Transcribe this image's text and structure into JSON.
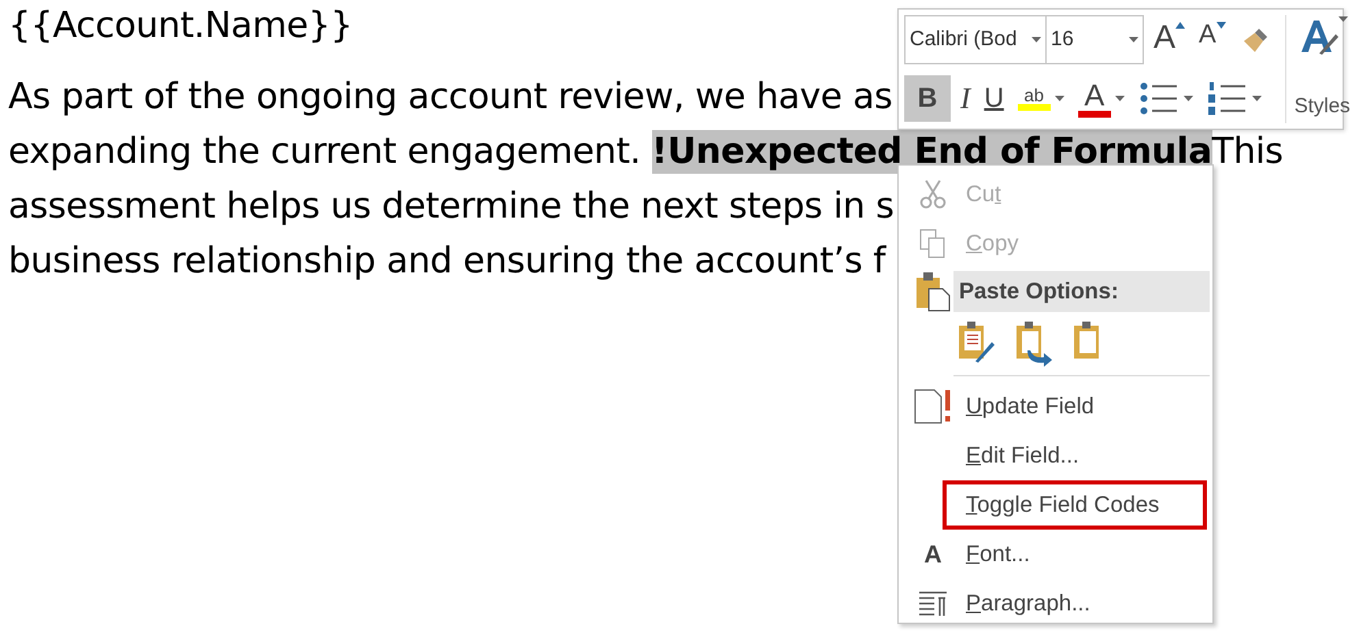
{
  "document": {
    "title": "{{Account.Name}}",
    "lines": [
      {
        "parts": [
          {
            "kind": "text",
            "text": "As part of the ongoing account review, we have as"
          }
        ]
      },
      {
        "parts": [
          {
            "kind": "text",
            "text": "expanding the current engagement. "
          },
          {
            "kind": "field",
            "text": "!Unexpected End of Formula",
            "selected": true
          },
          {
            "kind": "text",
            "text": "This"
          }
        ]
      },
      {
        "parts": [
          {
            "kind": "text",
            "text": "assessment helps us determine the next steps in s"
          }
        ]
      },
      {
        "parts": [
          {
            "kind": "text",
            "text": "business relationship and ensuring the account’s f"
          }
        ]
      }
    ]
  },
  "mini_toolbar": {
    "font_name": "Calibri (Bod",
    "font_size": "16",
    "row1": [
      {
        "kind": "grow",
        "label": "A"
      },
      {
        "kind": "shrink",
        "label": "A"
      },
      {
        "kind": "painter"
      }
    ],
    "row2": [
      {
        "kind": "bold",
        "label": "B",
        "selected": true
      },
      {
        "kind": "italic",
        "label": "I",
        "selected": false
      },
      {
        "kind": "underline",
        "label": "U",
        "selected": false
      },
      {
        "kind": "highlight",
        "label": "ab"
      },
      {
        "kind": "fontcolor",
        "label": "A"
      },
      {
        "kind": "bullets"
      },
      {
        "kind": "numbering"
      }
    ],
    "styles": {
      "label": "Styles"
    }
  },
  "context_menu": {
    "items": [
      {
        "kind": "cut",
        "before": "Cu",
        "key": "t",
        "disabled": true,
        "outlined": false
      },
      {
        "kind": "copy",
        "key": "C",
        "after": "opy",
        "disabled": true,
        "outlined": false
      },
      {
        "kind": "paste-header",
        "text": "Paste Options:"
      },
      {
        "kind": "paste-buttons"
      },
      {
        "kind": "separator"
      },
      {
        "kind": "update",
        "key": "U",
        "after": "pdate Field",
        "disabled": false,
        "outlined": false
      },
      {
        "kind": "plain",
        "key": "E",
        "after": "dit Field...",
        "disabled": false,
        "outlined": false
      },
      {
        "kind": "plain",
        "key": "T",
        "after": "oggle Field Codes",
        "disabled": false,
        "outlined": true
      },
      {
        "kind": "font",
        "icon_label": "A",
        "key": "F",
        "after": "ont...",
        "disabled": false,
        "outlined": false
      },
      {
        "kind": "paragraph",
        "key": "P",
        "after": "aragraph...",
        "disabled": false,
        "outlined": false
      }
    ]
  }
}
